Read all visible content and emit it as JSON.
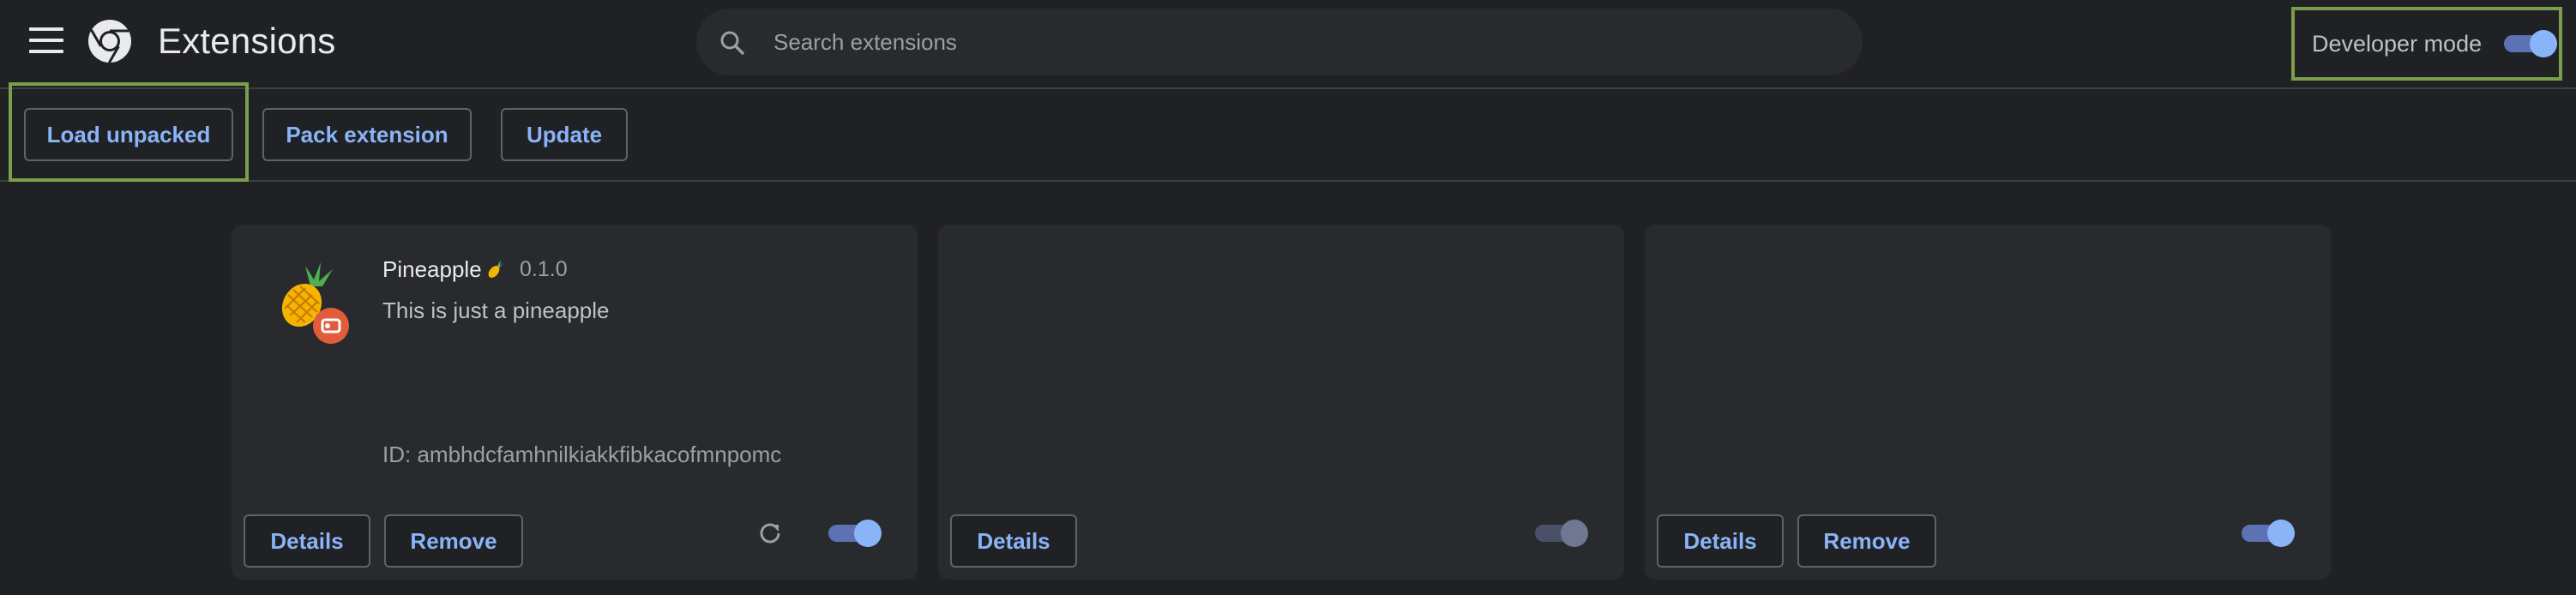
{
  "header": {
    "title": "Extensions",
    "search_placeholder": "Search extensions",
    "developer_mode_label": "Developer mode",
    "developer_mode_on": true
  },
  "toolbar": {
    "load_unpacked": "Load unpacked",
    "pack_extension": "Pack extension",
    "update": "Update"
  },
  "cards": [
    {
      "name": "Pineapple",
      "version": "0.1.0",
      "description": "This is just a pineapple",
      "id_text": "ID: ambhdcfamhnilkiakkfibkacofmnpomc",
      "details_label": "Details",
      "remove_label": "Remove",
      "enabled": true
    },
    {
      "details_label": "Details",
      "enabled": true
    },
    {
      "details_label": "Details",
      "remove_label": "Remove",
      "enabled": true
    }
  ],
  "colors": {
    "background": "#202124",
    "card": "#292a2d",
    "accent": "#8ab4f8",
    "highlight": "#7c9e4a"
  },
  "icons": [
    "menu-icon",
    "chrome-logo",
    "search-icon",
    "pineapple-icon",
    "reload-icon"
  ]
}
